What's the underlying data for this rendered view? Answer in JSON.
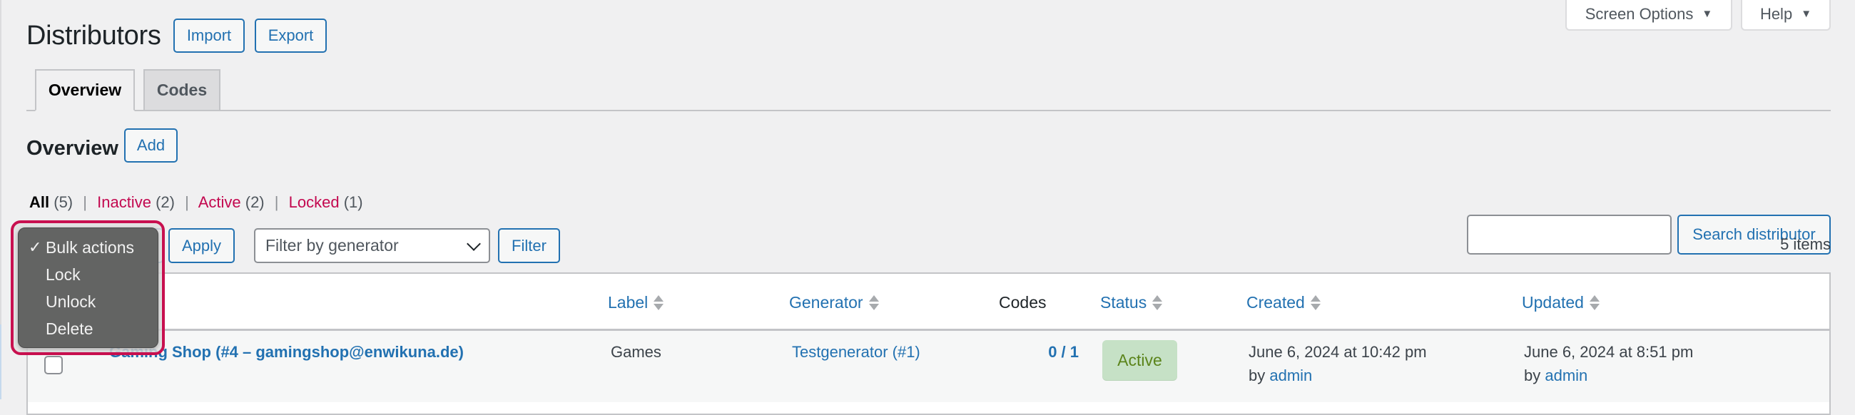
{
  "header": {
    "title": "Distributors",
    "import_label": "Import",
    "export_label": "Export",
    "screen_options_label": "Screen Options",
    "help_label": "Help",
    "dropdown_icon": "▼"
  },
  "tabs": [
    {
      "label": "Overview",
      "active": true
    },
    {
      "label": "Codes",
      "active": false
    }
  ],
  "section": {
    "title": "Overview",
    "add_label": "Add"
  },
  "status_filters": [
    {
      "label": "All",
      "count": "(5)",
      "current": true
    },
    {
      "label": "Inactive",
      "count": "(2)",
      "current": false
    },
    {
      "label": "Active",
      "count": "(2)",
      "current": false
    },
    {
      "label": "Locked",
      "count": "(1)",
      "current": false
    }
  ],
  "separator": "|",
  "toolbar": {
    "bulk_actions": {
      "selected": "Bulk actions",
      "options": [
        {
          "label": "Bulk actions",
          "checked": true,
          "check_glyph": "✓"
        },
        {
          "label": "Lock",
          "checked": false
        },
        {
          "label": "Unlock",
          "checked": false
        },
        {
          "label": "Delete",
          "checked": false
        }
      ]
    },
    "apply_label": "Apply",
    "generator_filter": {
      "selected": "Filter by generator"
    },
    "filter_label": "Filter",
    "search": {
      "value": "",
      "placeholder": "",
      "button_label": "Search distributor"
    },
    "items_count": "5 items"
  },
  "table": {
    "columns": [
      "Label",
      "Generator",
      "Codes",
      "Status",
      "Created",
      "Updated"
    ],
    "sortable": [
      true,
      true,
      false,
      true,
      true,
      true
    ],
    "rows": [
      {
        "title": "Gaming Shop (#4 – gamingshop@enwikuna.de)",
        "label": "Games",
        "generator": "Testgenerator (#1)",
        "codes": "0 / 1",
        "status": "Active",
        "created": "June 6, 2024 at 10:42 pm",
        "created_by_prefix": "by",
        "created_by": "admin",
        "updated": "June 6, 2024 at 8:51 pm",
        "updated_by_prefix": "by",
        "updated_by": "admin"
      }
    ]
  },
  "colors": {
    "accent": "#2271b1",
    "status_link": "#c3084f",
    "highlight_border": "#c8104f",
    "active_badge_bg": "#c6e1c6",
    "active_badge_text": "#5b841b"
  }
}
